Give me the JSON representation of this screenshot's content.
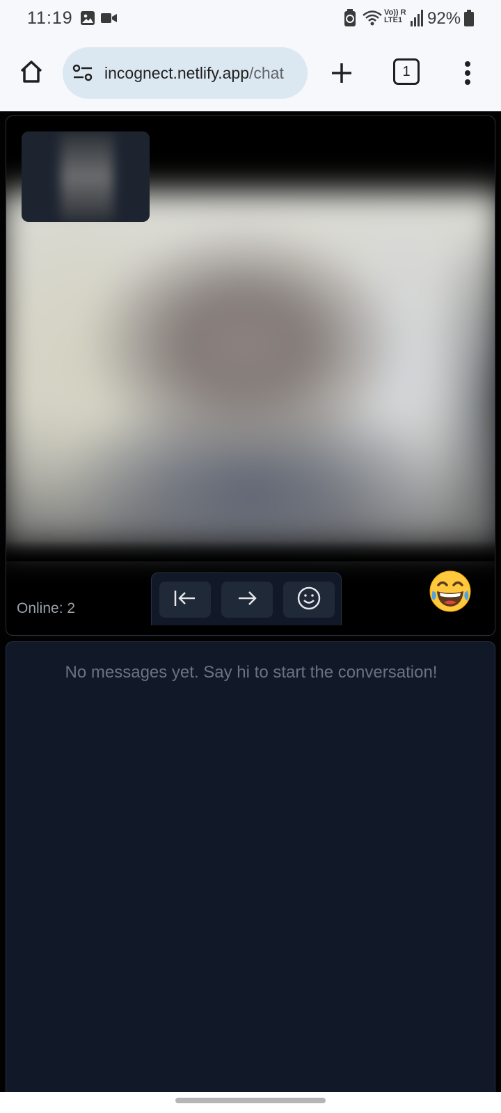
{
  "status_bar": {
    "time": "11:19",
    "battery": "92%",
    "icons": [
      "gallery-icon",
      "video-recording-icon",
      "battery-saver-icon",
      "wifi-icon",
      "volte-lte-icon",
      "signal-icon",
      "battery-icon"
    ],
    "network_label_1": "Vo)) R",
    "network_label_2": "LTE1"
  },
  "browser": {
    "url_domain": "incognect.netlify.app",
    "url_path": "/chat",
    "tab_count": "1",
    "icons": [
      "home-icon",
      "site-settings-icon",
      "new-tab-icon",
      "tab-switcher-icon",
      "more-menu-icon"
    ]
  },
  "video": {
    "online_label": "Online: 2",
    "controls": [
      "leave-icon",
      "next-icon",
      "emoji-icon"
    ],
    "reaction": "😂"
  },
  "chat": {
    "empty_text": "No messages yet. Say hi to start the conversation!"
  },
  "colors": {
    "page_bg": "#020202",
    "panel_bg": "#111827",
    "button_bg": "#1f2937",
    "muted_text": "#6b7280",
    "chrome_bg": "#f6f8fc",
    "url_pill_bg": "#dce8f1"
  }
}
